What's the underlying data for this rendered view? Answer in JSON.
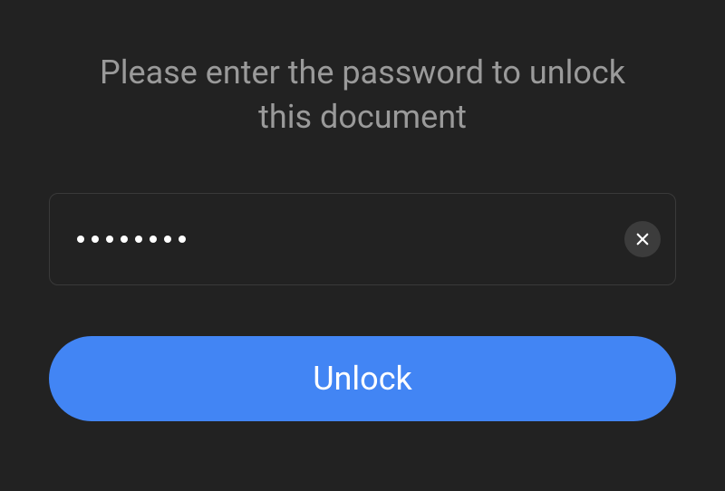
{
  "prompt": {
    "text": "Please enter the password to unlock this document"
  },
  "password": {
    "masked_length": 8,
    "placeholder": ""
  },
  "unlock": {
    "label": "Unlock"
  },
  "icons": {
    "clear": "close-icon"
  },
  "colors": {
    "background": "#222222",
    "text_muted": "#9a9a9a",
    "accent": "#4285f4",
    "input_border": "#3a3a3a",
    "clear_bg": "#3c3c3c"
  }
}
